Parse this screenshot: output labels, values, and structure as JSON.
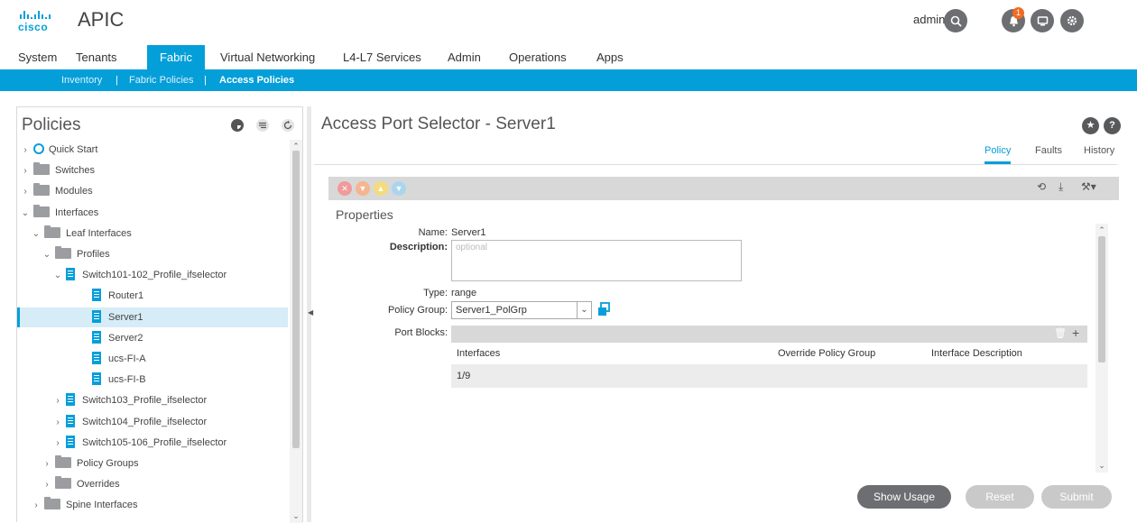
{
  "header": {
    "logo_text": "cisco",
    "app_title": "APIC",
    "user": "admin",
    "alert_count": "1",
    "icons": [
      "search-icon",
      "bell-icon",
      "monitor-icon",
      "gear-icon"
    ]
  },
  "nav": {
    "tabs": [
      {
        "label": "System",
        "active": false
      },
      {
        "label": "Tenants",
        "active": false
      },
      {
        "label": "Fabric",
        "active": true
      },
      {
        "label": "Virtual Networking",
        "active": false
      },
      {
        "label": "L4-L7 Services",
        "active": false
      },
      {
        "label": "Admin",
        "active": false
      },
      {
        "label": "Operations",
        "active": false
      },
      {
        "label": "Apps",
        "active": false
      }
    ],
    "sub": {
      "items": [
        "Inventory",
        "Fabric Policies",
        "Access Policies"
      ],
      "separator": "|",
      "active": "Access Policies"
    }
  },
  "sidebar": {
    "title": "Policies",
    "tree": [
      {
        "label": "Quick Start",
        "depth": 0,
        "icon": "quickstart",
        "chevron": "right"
      },
      {
        "label": "Switches",
        "depth": 0,
        "icon": "folder",
        "chevron": "right"
      },
      {
        "label": "Modules",
        "depth": 0,
        "icon": "folder",
        "chevron": "right"
      },
      {
        "label": "Interfaces",
        "depth": 0,
        "icon": "folder",
        "chevron": "down"
      },
      {
        "label": "Leaf Interfaces",
        "depth": 1,
        "icon": "folder",
        "chevron": "down"
      },
      {
        "label": "Profiles",
        "depth": 2,
        "icon": "folder",
        "chevron": "down"
      },
      {
        "label": "Switch101-102_Profile_ifselector",
        "depth": 3,
        "icon": "doc",
        "chevron": "down"
      },
      {
        "label": "Router1",
        "depth": 4,
        "icon": "doc",
        "chevron": ""
      },
      {
        "label": "Server1",
        "depth": 4,
        "icon": "doc",
        "chevron": "",
        "selected": true
      },
      {
        "label": "Server2",
        "depth": 4,
        "icon": "doc",
        "chevron": ""
      },
      {
        "label": "ucs-FI-A",
        "depth": 4,
        "icon": "doc",
        "chevron": ""
      },
      {
        "label": "ucs-FI-B",
        "depth": 4,
        "icon": "doc",
        "chevron": ""
      },
      {
        "label": "Switch103_Profile_ifselector",
        "depth": 3,
        "icon": "doc",
        "chevron": "right"
      },
      {
        "label": "Switch104_Profile_ifselector",
        "depth": 3,
        "icon": "doc",
        "chevron": "right"
      },
      {
        "label": "Switch105-106_Profile_ifselector",
        "depth": 3,
        "icon": "doc",
        "chevron": "right"
      },
      {
        "label": "Policy Groups",
        "depth": 2,
        "icon": "folder",
        "chevron": "right"
      },
      {
        "label": "Overrides",
        "depth": 2,
        "icon": "folder",
        "chevron": "right"
      },
      {
        "label": "Spine Interfaces",
        "depth": 1,
        "icon": "folder",
        "chevron": "right"
      }
    ]
  },
  "main": {
    "title": "Access Port Selector - Server1",
    "subtabs": [
      {
        "label": "Policy",
        "active": true
      },
      {
        "label": "Faults",
        "active": false
      },
      {
        "label": "History",
        "active": false
      }
    ],
    "properties_title": "Properties",
    "fields": {
      "name_label": "Name:",
      "name_value": "Server1",
      "description_label": "Description:",
      "description_placeholder": "optional",
      "type_label": "Type:",
      "type_value": "range",
      "policy_group_label": "Policy Group:",
      "policy_group_value": "Server1_PolGrp",
      "port_blocks_label": "Port Blocks:"
    },
    "port_blocks": {
      "columns": [
        "Interfaces",
        "Override Policy Group",
        "Interface Description"
      ],
      "rows": [
        {
          "interfaces": "1/9",
          "override": "",
          "description": ""
        }
      ]
    },
    "buttons": {
      "show_usage": "Show Usage",
      "reset": "Reset",
      "submit": "Submit"
    }
  },
  "colors": {
    "accent": "#049fd9",
    "critical": "#e2231a",
    "major": "#f26b21",
    "minor": "#ffcc00",
    "warning": "#64bbe3"
  }
}
